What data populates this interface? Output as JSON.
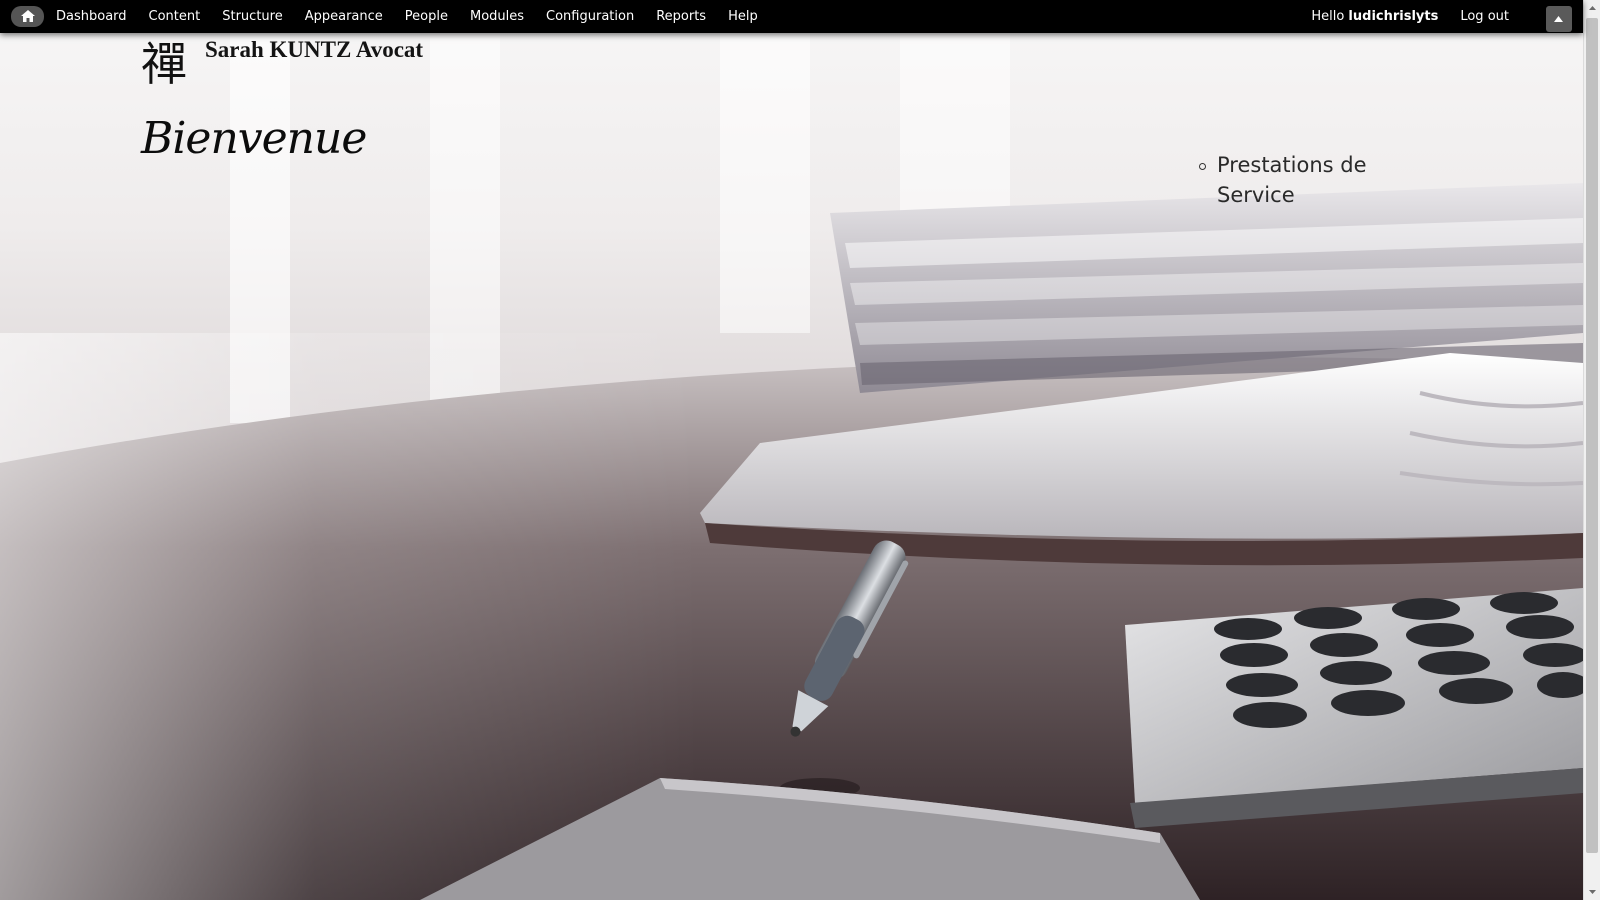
{
  "toolbar": {
    "home_icon": "home-icon",
    "menu": [
      {
        "label": "Dashboard"
      },
      {
        "label": "Content"
      },
      {
        "label": "Structure"
      },
      {
        "label": "Appearance"
      },
      {
        "label": "People"
      },
      {
        "label": "Modules"
      },
      {
        "label": "Configuration"
      },
      {
        "label": "Reports"
      },
      {
        "label": "Help"
      }
    ],
    "hello_prefix": "Hello ",
    "username": "ludichrislyts",
    "logout_label": "Log out",
    "drawer_icon": "triangle-up-icon"
  },
  "site": {
    "logo_glyph": "禪",
    "name": "Sarah KUNTZ Avocat"
  },
  "page": {
    "title": "Bienvenue"
  },
  "side_menu": {
    "items": [
      {
        "label": "Prestations de Service"
      }
    ]
  },
  "colors": {
    "toolbar_bg": "#000000",
    "toolbar_text": "#ffffff",
    "home_button_bg": "#555555"
  }
}
